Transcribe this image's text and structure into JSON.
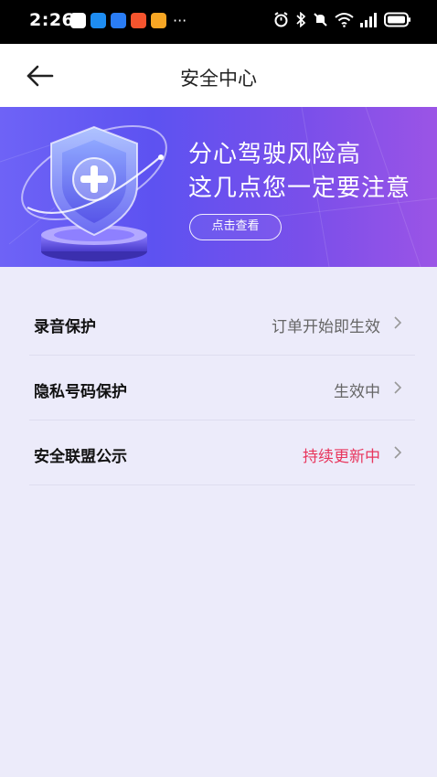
{
  "status_bar": {
    "time": "2:26",
    "more": "···"
  },
  "nav": {
    "title": "安全中心"
  },
  "banner": {
    "line1": "分心驾驶风险高",
    "line2": "这几点您一定要注意",
    "button_label": "点击查看"
  },
  "settings": [
    {
      "label": "录音保护",
      "status": "订单开始即生效",
      "status_color": "#666666"
    },
    {
      "label": "隐私号码保护",
      "status": "生效中",
      "status_color": "#666666"
    },
    {
      "label": "安全联盟公示",
      "status": "持续更新中",
      "status_color": "#E8365D"
    }
  ],
  "colors": {
    "accent": "#5D52F1",
    "alert": "#E8365D",
    "background": "#ECEBFA"
  }
}
